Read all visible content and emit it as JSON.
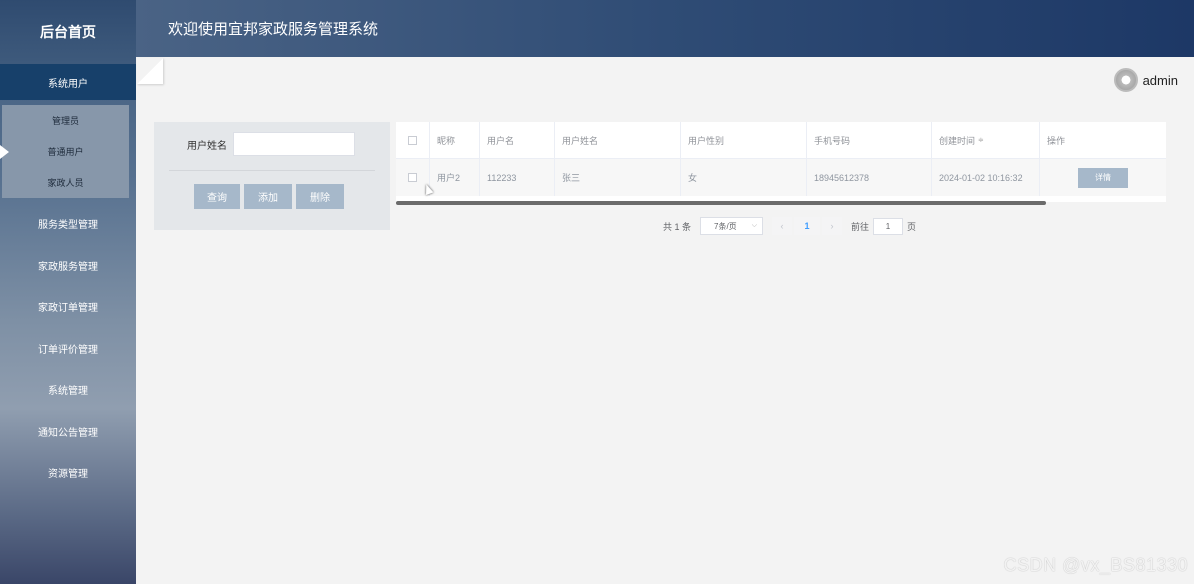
{
  "header": {
    "title": "欢迎使用宜邦家政服务管理系统"
  },
  "user": {
    "name": "admin"
  },
  "sidebar": {
    "home": "后台首页",
    "active_group": "系统用户",
    "submenu": [
      "管理员",
      "普通用户",
      "家政人员"
    ],
    "items": [
      "服务类型管理",
      "家政服务管理",
      "家政订单管理",
      "订单评价管理",
      "系统管理",
      "通知公告管理",
      "资源管理"
    ]
  },
  "search": {
    "label": "用户姓名",
    "placeholder": "",
    "buttons": {
      "query": "查询",
      "add": "添加",
      "delete": "删除"
    }
  },
  "table": {
    "headers": [
      "昵称",
      "用户名",
      "用户姓名",
      "用户性别",
      "手机号码",
      "创建时间",
      "操作"
    ],
    "rows": [
      {
        "nickname": "用户2",
        "username": "112233",
        "realname": "张三",
        "gender": "女",
        "phone": "18945612378",
        "created": "2024-01-02 10:16:32",
        "action": "详情"
      }
    ]
  },
  "pagination": {
    "total": "共 1 条",
    "page_size": "7条/页",
    "prev": "‹",
    "next": "›",
    "current": "1",
    "goto_label": "前往",
    "goto_value": "1",
    "page_suffix": "页"
  },
  "watermark": "CSDN @vx_BS81330"
}
